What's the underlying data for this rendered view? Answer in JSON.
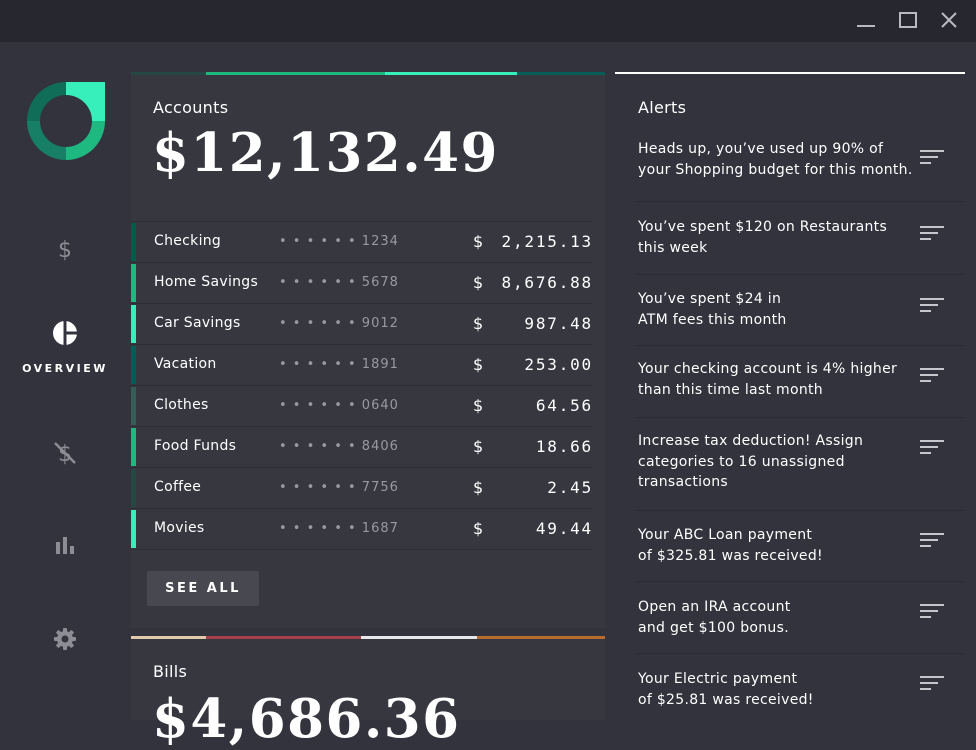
{
  "window": {
    "controls": {
      "minimize_icon": "minimize-icon",
      "maximize_icon": "maximize-icon",
      "close_icon": "close-icon"
    }
  },
  "sidebar": {
    "logo_icon": "donut-logo-icon",
    "items": [
      {
        "id": "accounts",
        "icon": "dollar-icon",
        "label": "",
        "active": false
      },
      {
        "id": "overview",
        "icon": "pie-chart-icon",
        "label": "OVERVIEW",
        "active": true
      },
      {
        "id": "bills",
        "icon": "dollar-strike-icon",
        "label": "",
        "active": false
      },
      {
        "id": "budgets",
        "icon": "bar-chart-icon",
        "label": "",
        "active": false
      },
      {
        "id": "settings",
        "icon": "gear-icon",
        "label": "",
        "active": false
      }
    ]
  },
  "accounts": {
    "title": "Accounts",
    "total": "$12,132.49",
    "see_all_label": "SEE ALL",
    "currency_symbol": "$",
    "rows": [
      {
        "name": "Checking",
        "mask": "• • • • • • 1234",
        "amount": "2,215.13",
        "color": "#005d4a"
      },
      {
        "name": "Home Savings",
        "mask": "• • • • • • 5678",
        "amount": "8,676.88",
        "color": "#1eb980"
      },
      {
        "name": "Car Savings",
        "mask": "• • • • • • 9012",
        "amount": "987.48",
        "color": "#37efba"
      },
      {
        "name": "Vacation",
        "mask": "• • • • • • 1891",
        "amount": "253.00",
        "color": "#045d56"
      },
      {
        "name": "Clothes",
        "mask": "• • • • • • 0640",
        "amount": "64.56",
        "color": "#355e58"
      },
      {
        "name": "Food Funds",
        "mask": "• • • • • • 8406",
        "amount": "18.66",
        "color": "#1eb980"
      },
      {
        "name": "Coffee",
        "mask": "• • • • • • 7756",
        "amount": "2.45",
        "color": "#254842"
      },
      {
        "name": "Movies",
        "mask": "• • • • • • 1687",
        "amount": "49.44",
        "color": "#37efba"
      }
    ]
  },
  "bills": {
    "title": "Bills",
    "total": "$4,686.36"
  },
  "alerts": {
    "title": "Alerts",
    "item_icon": "sort-lines-icon",
    "items": [
      {
        "lines": [
          "Heads up, you’ve used up 90% of",
          "your Shopping budget for this month."
        ]
      },
      {
        "lines": [
          "You’ve spent $120 on Restaurants",
          "this week"
        ]
      },
      {
        "lines": [
          "You’ve spent $24 in",
          "ATM fees this month"
        ]
      },
      {
        "lines": [
          "Your checking account is 4% higher",
          "than this time last month"
        ]
      },
      {
        "lines": [
          "Increase tax deduction! Assign",
          "categories to 16 unassigned",
          "transactions"
        ]
      },
      {
        "lines": [
          "Your ABC Loan payment",
          "of $325.81 was received!"
        ]
      },
      {
        "lines": [
          "Open an IRA account",
          "and get $100 bonus."
        ]
      },
      {
        "lines": [
          "Your Electric payment",
          "of $25.81 was received!"
        ]
      }
    ]
  },
  "colors": {
    "background": "#33333d",
    "panel": "#373740",
    "titlebar": "#27272f",
    "accent_green": "#1eb980",
    "accent_bright": "#37efba",
    "muted_icon": "#8d8d96",
    "bills_red": "#a63e4c",
    "bills_orange": "#b86b2f"
  }
}
